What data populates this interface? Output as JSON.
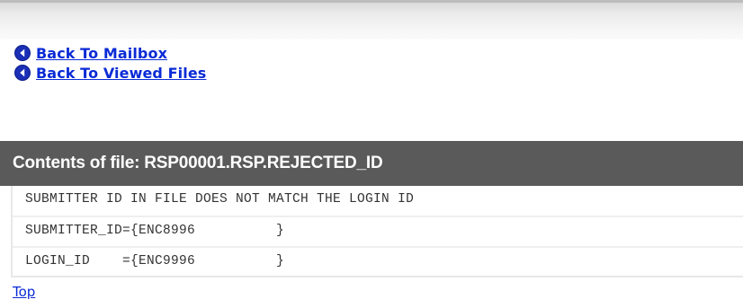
{
  "nav": {
    "back_to_mailbox": "Back To Mailbox",
    "back_to_viewed_files": "Back To Viewed Files",
    "icon": "arrow-left-circle-icon",
    "icon_color": "#1a2fb5"
  },
  "file": {
    "header": "Contents of file: RSP00001.RSP.REJECTED_ID",
    "lines": [
      "SUBMITTER ID IN FILE DOES NOT MATCH THE LOGIN ID",
      "SUBMITTER_ID={ENC8996          }",
      "LOGIN_ID    ={ENC9996          }"
    ]
  },
  "footer": {
    "top_link": "Top"
  },
  "colors": {
    "link": "#0a2bd6",
    "header_bg": "#5a5a5a",
    "header_text": "#ffffff",
    "mono_text": "#333333"
  }
}
